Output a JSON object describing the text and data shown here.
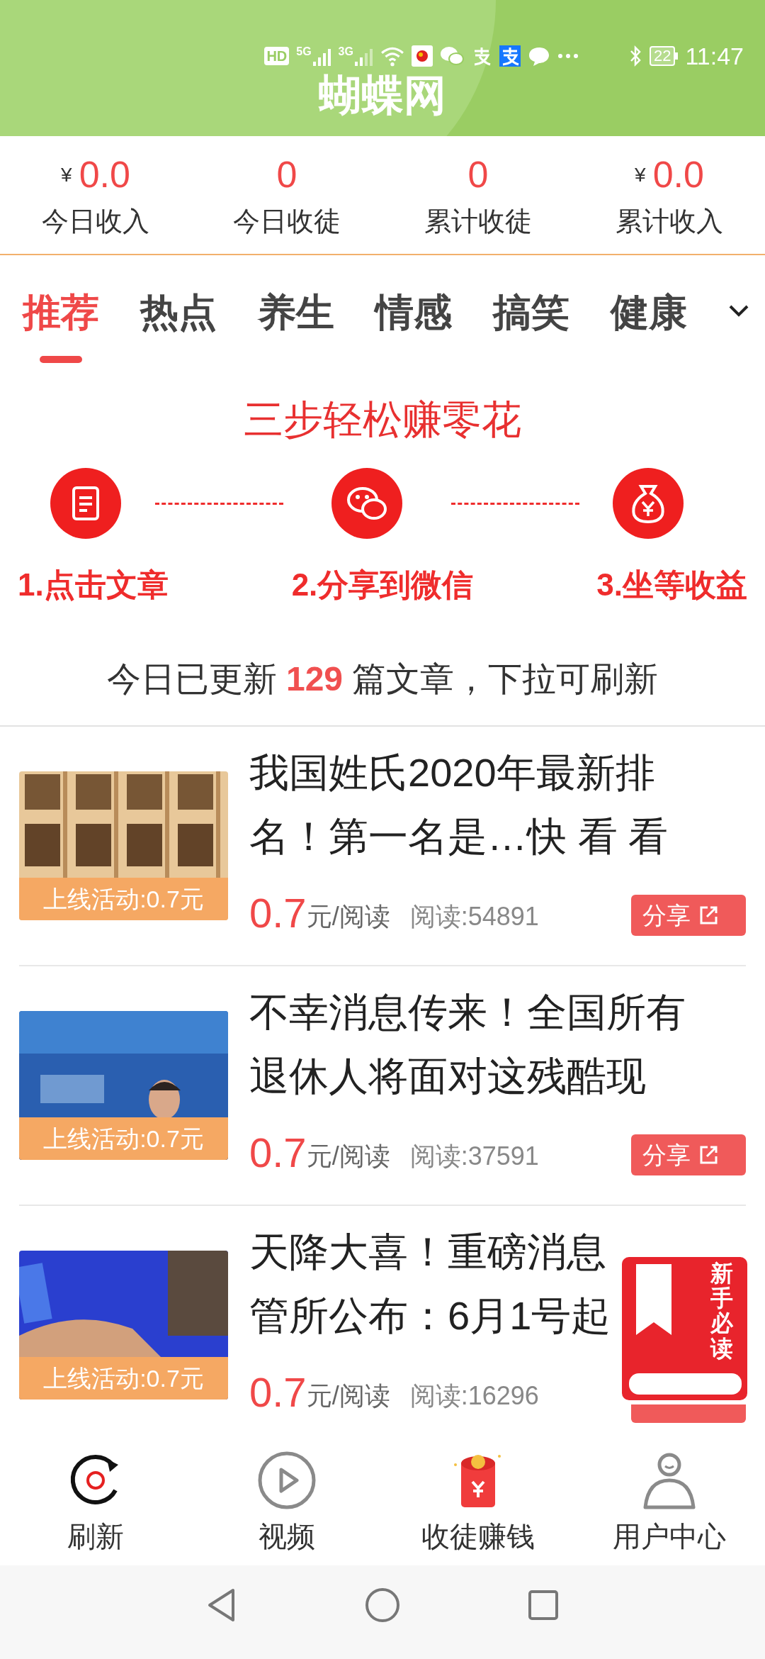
{
  "status_bar": {
    "network_labels": [
      "HD",
      "5G",
      "3G"
    ],
    "battery": "22",
    "time": "11:47"
  },
  "app_title": "蝴蝶网",
  "stats": [
    {
      "currency": "¥",
      "value": "0.0",
      "label": "今日收入"
    },
    {
      "value": "0",
      "label": "今日收徒"
    },
    {
      "value": "0",
      "label": "累计收徒"
    },
    {
      "currency": "¥",
      "value": "0.0",
      "label": "累计收入"
    }
  ],
  "tabs": [
    {
      "label": "推荐",
      "selected": true
    },
    {
      "label": "热点",
      "selected": false
    },
    {
      "label": "养生",
      "selected": false
    },
    {
      "label": "情感",
      "selected": false
    },
    {
      "label": "搞笑",
      "selected": false
    },
    {
      "label": "健康",
      "selected": false
    }
  ],
  "steps_title": "三步轻松赚零花",
  "steps": [
    {
      "kind": "article",
      "label": "1.点击文章"
    },
    {
      "kind": "wechat",
      "label": "2.分享到微信"
    },
    {
      "kind": "moneybag",
      "label": "3.坐等收益"
    }
  ],
  "update_notice": "今日已更新 **129** 篇文章，下拉可刷新",
  "articles": [
    {
      "title_lines": [
        "我国姓氏2020年最新排",
        "名！第一名是…快 看 看"
      ],
      "promo": "上线活动:0.7元",
      "price": "0.7",
      "price_unit": "元/阅读",
      "reads": "阅读:54891",
      "share": "分享"
    },
    {
      "title_lines": [
        "不幸消息传来！全国所有",
        "退休人将面对这残酷现"
      ],
      "promo": "上线活动:0.7元",
      "price": "0.7",
      "price_unit": "元/阅读",
      "reads": "阅读:37591",
      "share": "分享"
    },
    {
      "title_lines": [
        "天降大喜！重磅消息",
        "管所公布：6月1号起"
      ],
      "promo": "上线活动:0.7元",
      "price": "0.7",
      "price_unit": "元/阅读",
      "reads": "阅读:16296"
    }
  ],
  "floating_badge": "新手必读",
  "bottom_nav": [
    {
      "kind": "refresh",
      "label": "刷新"
    },
    {
      "kind": "video",
      "label": "视频"
    },
    {
      "kind": "redpacket",
      "label": "收徒赚钱"
    },
    {
      "kind": "user",
      "label": "用户中心"
    }
  ]
}
